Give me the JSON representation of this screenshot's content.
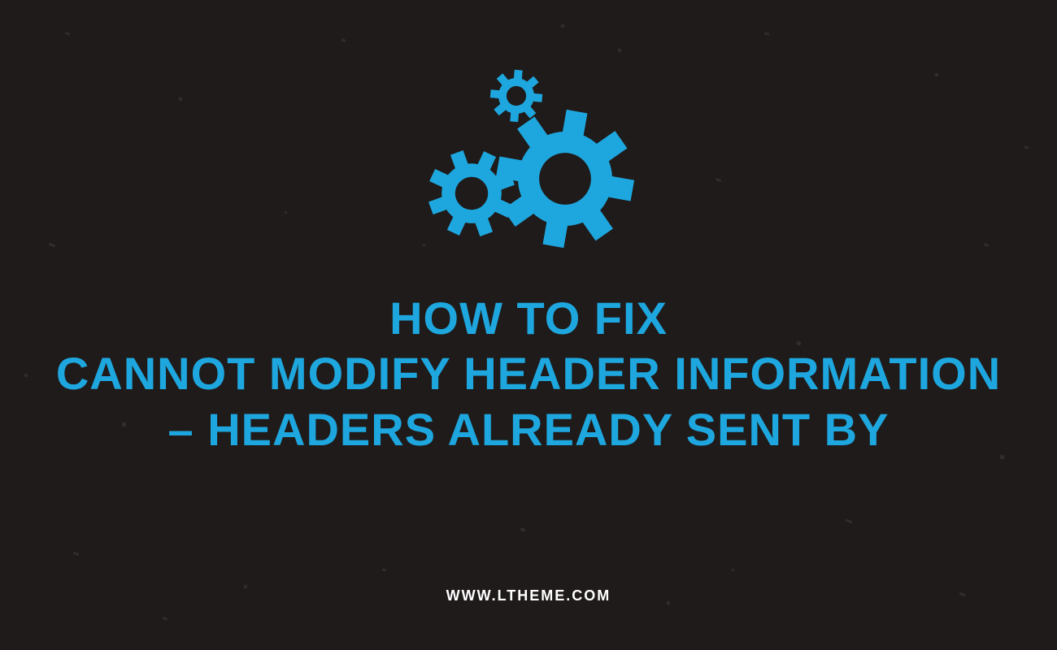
{
  "accent_color": "#1ea7df",
  "background_color": "#1f1b1a",
  "headline": {
    "line1": "HOW TO FIX",
    "line2": "CANNOT MODIFY HEADER INFORMATION",
    "line3": "– HEADERS ALREADY SENT BY"
  },
  "footer_url": "WWW.LTHEME.COM",
  "icon_name": "gears-icon"
}
